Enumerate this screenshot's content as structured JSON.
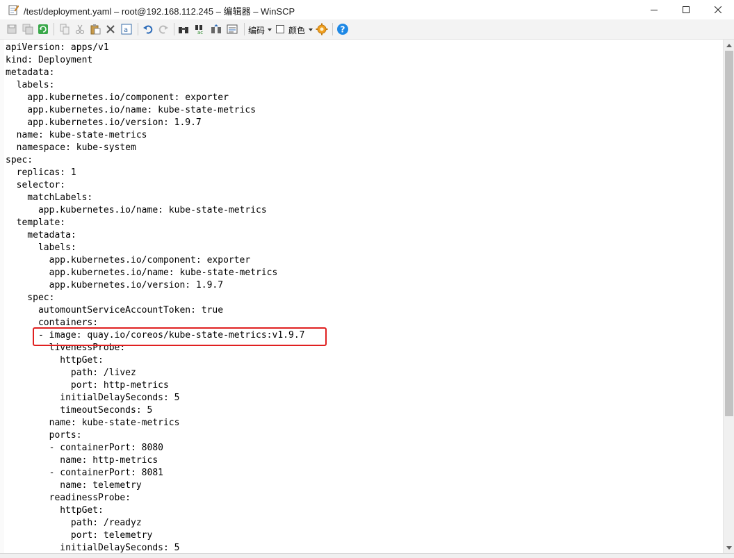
{
  "window": {
    "title": "/test/deployment.yaml – root@192.168.112.245 – 编辑器 – WinSCP"
  },
  "toolbar": {
    "encoding_label": "编码",
    "color_label": "颜色",
    "icons": [
      "save-icon",
      "save-all-icon",
      "reload-icon",
      "copy-icon",
      "cut-icon",
      "paste-icon",
      "delete-icon",
      "select-all-icon",
      "undo-icon",
      "redo-icon",
      "find-icon",
      "replace-icon",
      "find-next-icon",
      "goto-line-icon",
      "settings-icon",
      "help-icon"
    ]
  },
  "editor": {
    "lines": [
      "apiVersion: apps/v1",
      "kind: Deployment",
      "metadata:",
      "  labels:",
      "    app.kubernetes.io/component: exporter",
      "    app.kubernetes.io/name: kube-state-metrics",
      "    app.kubernetes.io/version: 1.9.7",
      "  name: kube-state-metrics",
      "  namespace: kube-system",
      "spec:",
      "  replicas: 1",
      "  selector:",
      "    matchLabels:",
      "      app.kubernetes.io/name: kube-state-metrics",
      "  template:",
      "    metadata:",
      "      labels:",
      "        app.kubernetes.io/component: exporter",
      "        app.kubernetes.io/name: kube-state-metrics",
      "        app.kubernetes.io/version: 1.9.7",
      "    spec:",
      "      automountServiceAccountToken: true",
      "      containers:",
      "      - image: quay.io/coreos/kube-state-metrics:v1.9.7",
      "        livenessProbe:",
      "          httpGet:",
      "            path: /livez",
      "            port: http-metrics",
      "          initialDelaySeconds: 5",
      "          timeoutSeconds: 5",
      "        name: kube-state-metrics",
      "        ports:",
      "        - containerPort: 8080",
      "          name: http-metrics",
      "        - containerPort: 8081",
      "          name: telemetry",
      "        readinessProbe:",
      "          httpGet:",
      "            path: /readyz",
      "            port: telemetry",
      "          initialDelaySeconds: 5"
    ]
  },
  "colors": {
    "highlight_border": "#e02020",
    "help_icon": "#1e88e5",
    "settings_icon": "#f0a020"
  }
}
